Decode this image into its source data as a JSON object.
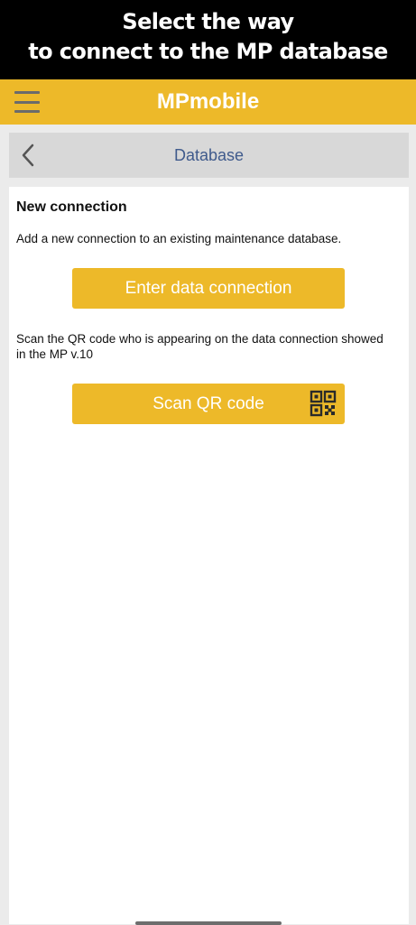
{
  "banner": {
    "line1": "Select the way",
    "line2": "to connect to the MP database"
  },
  "appbar": {
    "title": "MPmobile",
    "menu_icon": "hamburger-menu-icon",
    "accent_color": "#edb929"
  },
  "navbar": {
    "title": "Database",
    "back_icon": "chevron-left-icon"
  },
  "content": {
    "heading": "New connection",
    "description": "Add a new connection to an existing maintenance database.",
    "enter_button_label": "Enter data connection",
    "scan_description": "Scan the QR code who is appearing on the data connection showed in the MP v.10",
    "scan_button_label": "Scan QR code",
    "scan_button_icon": "qr-code-icon"
  }
}
